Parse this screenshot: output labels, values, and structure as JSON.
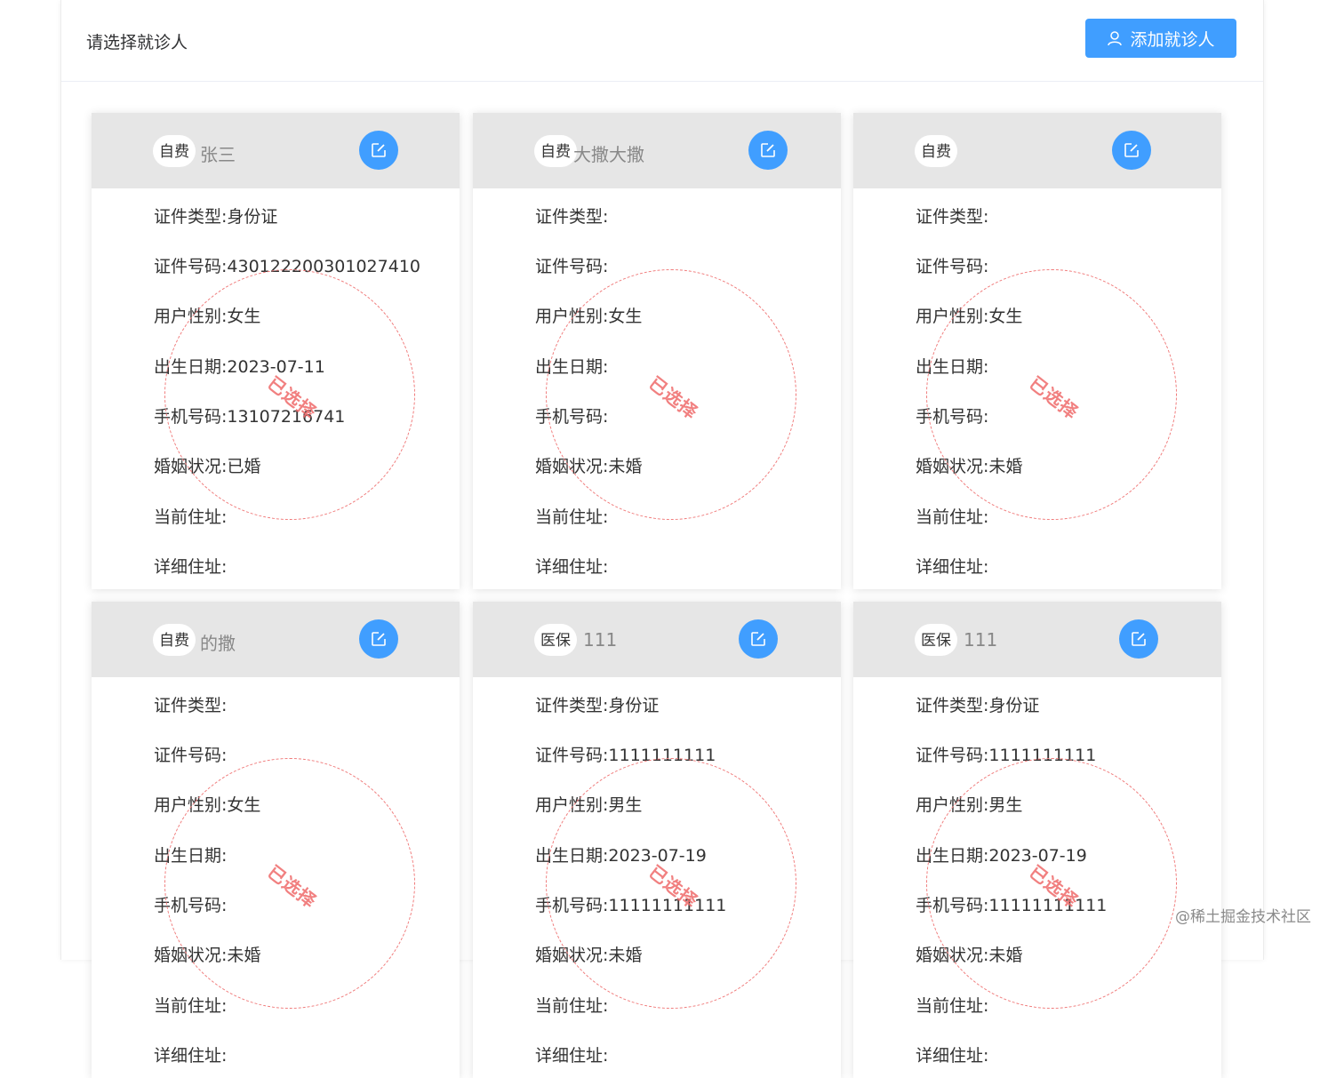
{
  "header": {
    "title": "请选择就诊人",
    "add_button_label": "添加就诊人",
    "add_button_icon": "user-icon"
  },
  "labels": {
    "id_type": "证件类型:",
    "id_number": "证件号码:",
    "gender": "用户性别:",
    "birth_date": "出生日期:",
    "phone": "手机号码:",
    "marital": "婚姻状况:",
    "current_address": "当前住址:",
    "detail_address": "详细住址:"
  },
  "stamp_text": "已选择",
  "edit_icon": "edit-icon",
  "patients": [
    {
      "tag": "自费",
      "name": "张三",
      "id_type": "身份证",
      "id_number": "430122200301027410",
      "gender": "女生",
      "birth_date": "2023-07-11",
      "phone": "13107216741",
      "marital": "已婚",
      "current_address": "",
      "detail_address": ""
    },
    {
      "tag": "自费",
      "name": "大撒大撒",
      "id_type": "",
      "id_number": "",
      "gender": "女生",
      "birth_date": "",
      "phone": "",
      "marital": "未婚",
      "current_address": "",
      "detail_address": ""
    },
    {
      "tag": "自费",
      "name": "",
      "id_type": "",
      "id_number": "",
      "gender": "女生",
      "birth_date": "",
      "phone": "",
      "marital": "未婚",
      "current_address": "",
      "detail_address": ""
    },
    {
      "tag": "自费",
      "name": "的撒",
      "id_type": "",
      "id_number": "",
      "gender": "女生",
      "birth_date": "",
      "phone": "",
      "marital": "未婚",
      "current_address": "",
      "detail_address": ""
    },
    {
      "tag": "医保",
      "name": "111",
      "id_type": "身份证",
      "id_number": "1111111111",
      "gender": "男生",
      "birth_date": "2023-07-19",
      "phone": "11111111111",
      "marital": "未婚",
      "current_address": "",
      "detail_address": ""
    },
    {
      "tag": "医保",
      "name": "111",
      "id_type": "身份证",
      "id_number": "1111111111",
      "gender": "男生",
      "birth_date": "2023-07-19",
      "phone": "11111111111",
      "marital": "未婚",
      "current_address": "",
      "detail_address": ""
    }
  ],
  "watermark": "@稀土掘金技术社区",
  "colors": {
    "accent": "#409eff",
    "stamp": "#ef6b6b",
    "card_header": "#e6e6e6"
  }
}
